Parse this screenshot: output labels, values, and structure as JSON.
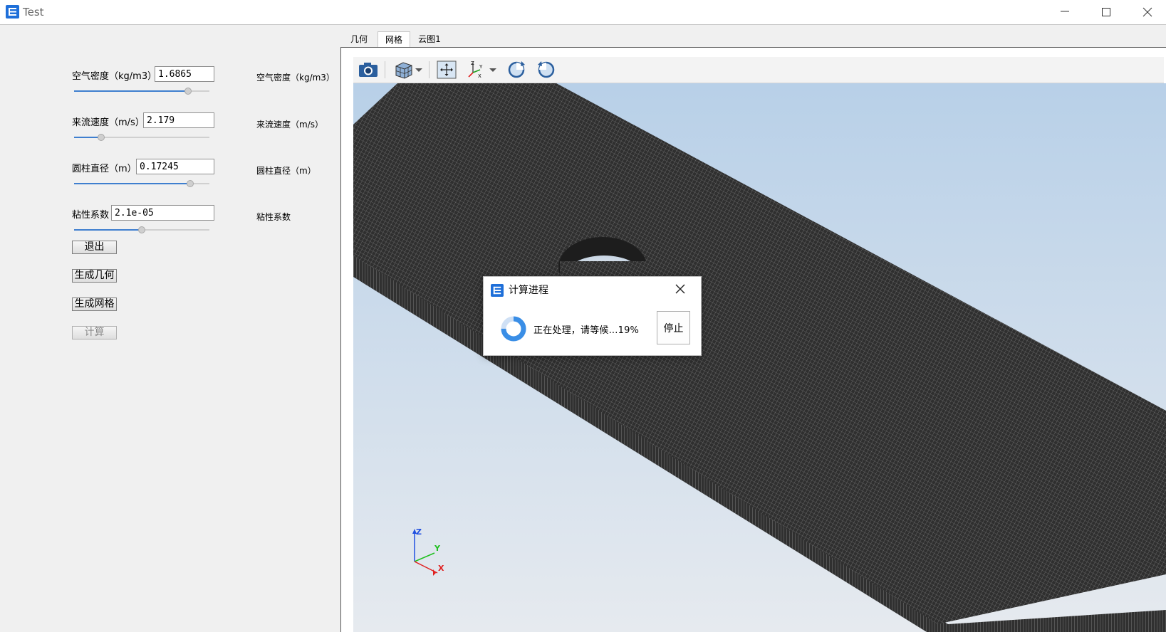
{
  "window": {
    "title": "Test"
  },
  "params": [
    {
      "label": "空气密度（kg/m3）",
      "value": "1.6865",
      "side_label": "空气密度（kg/m3）",
      "slider_fraction": 0.84
    },
    {
      "label": "来流速度（m/s）",
      "value": "2.179",
      "side_label": "来流速度（m/s）",
      "slider_fraction": 0.2
    },
    {
      "label": "圆柱直径（m）",
      "value": "0.17245",
      "side_label": "圆柱直径（m）",
      "slider_fraction": 0.86
    },
    {
      "label": "粘性系数",
      "value": "2.1e-05",
      "side_label": "粘性系数",
      "slider_fraction": 0.5
    }
  ],
  "buttons": {
    "exit": "退出",
    "gen_geometry": "生成几何",
    "gen_mesh": "生成网格",
    "compute": "计算"
  },
  "tabs": [
    {
      "label": "几何"
    },
    {
      "label": "网格"
    },
    {
      "label": "云图1"
    }
  ],
  "active_tab": "网格",
  "toolbar_icons": [
    "camera-icon",
    "cube-view-icon",
    "dropdown-arrow-icon",
    "fit-view-icon",
    "axes-orient-icon",
    "dropdown-arrow-icon",
    "rotate-cw-icon",
    "rotate-ccw-icon"
  ],
  "axes": {
    "z": "Z",
    "y": "Y",
    "x": "X"
  },
  "dialog": {
    "title": "计算进程",
    "message": "正在处理，请等候...19%",
    "progress": 0.19,
    "stop_label": "停止"
  },
  "colors": {
    "viewport_top": "#b8d0e8",
    "viewport_bottom": "#e6eaef",
    "mesh": "#3a3a3a",
    "accent": "#1e6fd9",
    "axis_x": "#e02020",
    "axis_y": "#20c020",
    "axis_z": "#2050e0"
  }
}
